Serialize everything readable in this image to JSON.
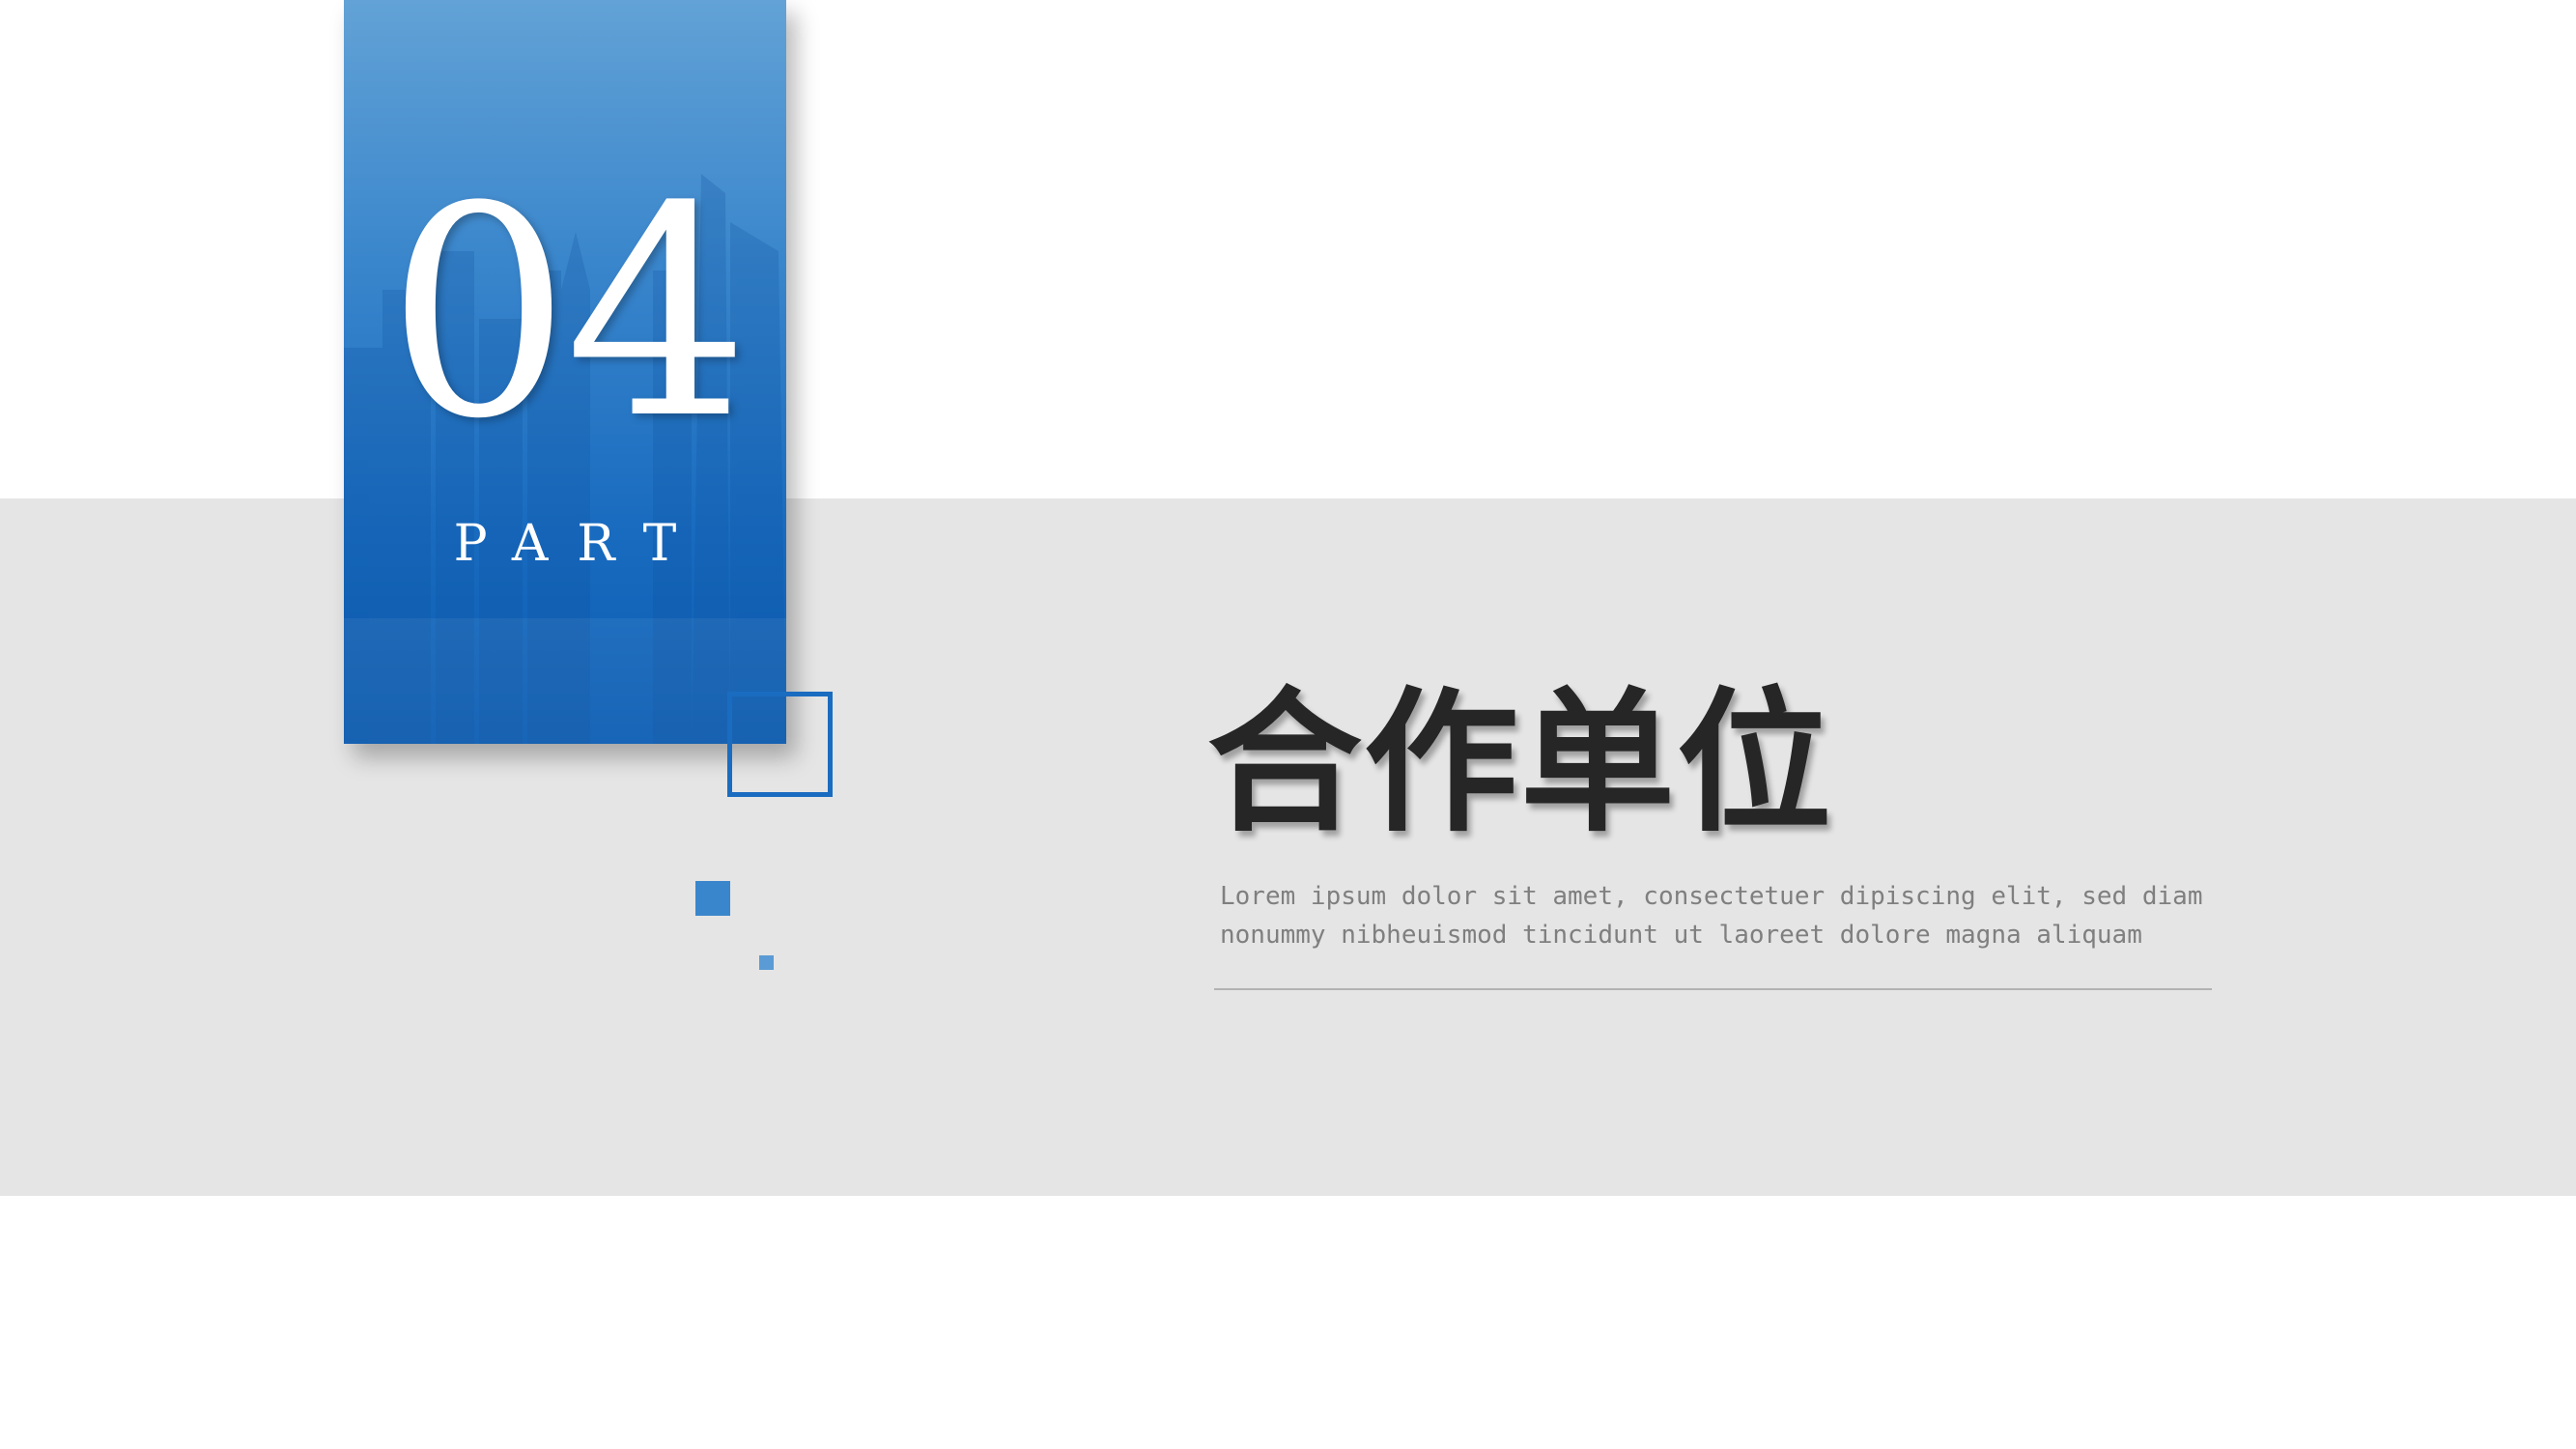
{
  "slide": {
    "section_number": "04",
    "section_label": "PART",
    "title": "合作单位",
    "description_lines": [
      "Lorem ipsum dolor sit amet, consectetuer dipiscing elit, sed diam",
      "nonummy nibheuismod tincidunt ut laoreet dolore magna aliquam"
    ]
  },
  "colors": {
    "accent_blue": "#1a6cc0",
    "band_gray": "#e5e5e5",
    "title_text": "#262626",
    "body_text": "#7f7f7f"
  },
  "icons": {
    "card_background": "city-skyline-image"
  }
}
